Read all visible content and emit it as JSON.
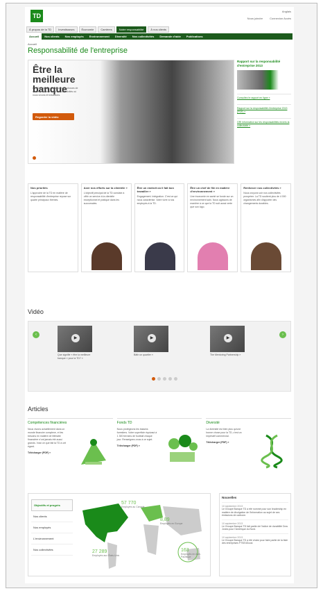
{
  "header": {
    "logo": "TD",
    "util_top": "Anglais",
    "util_links": [
      "Nous joindre",
      "Connexion Accès"
    ]
  },
  "top_tabs": [
    {
      "label": "À propos de la TD",
      "active": false
    },
    {
      "label": "Investisseurs",
      "active": false
    },
    {
      "label": "Économie",
      "active": false
    },
    {
      "label": "Carrières",
      "active": false
    },
    {
      "label": "Notre responsabilité",
      "active": true
    },
    {
      "label": "À nos clients",
      "active": false
    }
  ],
  "nav": [
    {
      "label": "Accueil",
      "active": true
    },
    {
      "label": "Nos clients",
      "active": false
    },
    {
      "label": "Nos employés",
      "active": false
    },
    {
      "label": "Environnement",
      "active": false
    },
    {
      "label": "Diversité",
      "active": false
    },
    {
      "label": "Nos collectivités",
      "active": false
    },
    {
      "label": "Demande d'aide",
      "active": false
    },
    {
      "label": "Publications",
      "active": false
    }
  ],
  "breadcrumb": "Accueil",
  "page_title": "Responsabilité de l'entreprise",
  "hero": {
    "title": "Être la meilleure banque",
    "text": "La TD s'engage à améliorer les choses de manière durable dans les collectivités où nous vivons et travaillons.",
    "button": "Regarder la vidéo"
  },
  "side": {
    "title": "Rapport sur la responsabilité d'entreprise 2013",
    "links": [
      "Consultez le rapport en ligne »",
      "Rapport sur la responsabilité d'entreprise 2013 (PDF) »",
      "GRI Information sur les responsabilités envers la collectivité »"
    ]
  },
  "cards": [
    {
      "title": "Nos priorités",
      "text": "L'approche de la TD en matière de responsabilité d'entreprise repose sur quatre principaux thèmes."
    },
    {
      "title": "Axer nos efforts sur la clientèle »",
      "text": "L'objectif principal de la TD consiste à offrir un service à la clientèle exceptionnel et pratique dans les succursales."
    },
    {
      "title": "Être un endroit où il fait bon travailler »",
      "text": "Engagement. Intégration. C'est ce qui nous caractérise. Votre vivre à nos employés à la TD."
    },
    {
      "title": "Être un chef de file en matière d'environnement »",
      "text": "Une économie en santé se fonde sur un environnement sain. Nous agissons de manière à ce que la TD soit aussi verte que son logo."
    },
    {
      "title": "Renforcer nos collectivités »",
      "text": "Nous croyons voir nos collectivités prospérer. La TD soutient plus de 4 000 organismes afin d'apporter des changements durables."
    }
  ],
  "video": {
    "heading": "Vidéo",
    "items": [
      {
        "caption": "Que signifie « être la meilleure banque » pour la TD? »"
      },
      {
        "caption": "Bâtir un quartier »"
      },
      {
        "caption": "The Mentoring Partnership »"
      }
    ],
    "page_count": 5,
    "active_page": 0
  },
  "articles": {
    "heading": "Articles",
    "items": [
      {
        "title": "Compétences financières",
        "text": "Nous vivons actuellement dans un monde financier complexe, et les besoins en matière de littératie financière n'ont jamais été aussi grands. Voici ce que fait la TD à cet égard.",
        "link": "Télécharger (PDF) »"
      },
      {
        "title": "Fonds TD",
        "text": "Nous protégeons les bassins forestiers. Votre superficie équivaut à 1 300 terrains de football chaque jour. Renseignez-vous à ce sujet.",
        "link": "Télécharger (PDF) »"
      },
      {
        "title": "Diversité",
        "text": "La diversité est bien plus qu'une bonne chose pour la TD, c'est un impératif commercial.",
        "link": "Télécharger (PDF) »"
      }
    ]
  },
  "objectives": {
    "menu": [
      "Objectifs et progrès",
      "Nos clients",
      "Nos employés",
      "L'environnement",
      "Nos collectivités"
    ],
    "active": 0,
    "stats": [
      {
        "value": "57 770",
        "label": "Employés au Canada"
      },
      {
        "value": "8,89",
        "label": "Employés en Europe"
      },
      {
        "value": "27 289",
        "label": "Employés aux États-Unis"
      },
      {
        "value": "163",
        "label": "Employés en Asie-Pacifique"
      }
    ]
  },
  "news": {
    "title": "Nouvelles",
    "items": [
      {
        "date": "10 septembre 2013",
        "text": "Le Groupe Banque TD a été nommé pour son leadership en matière de divulgation de l'information au sujet de ses émissions de carbone."
      },
      {
        "date": "10 septembre 2013",
        "text": "Le Groupe Banque TD fait partie de l'indice de durabilité Dow Jones pour l'Amérique du Nord."
      },
      {
        "date": "10 septembre 2013",
        "text": "Le Groupe Banque TD a été choisi pour faire partie de la liste des entreprises FTSE4Good."
      }
    ]
  },
  "colors": {
    "brand": "#1a8a1a",
    "nav": "#1d5b1d",
    "accent": "#d25a0b"
  }
}
